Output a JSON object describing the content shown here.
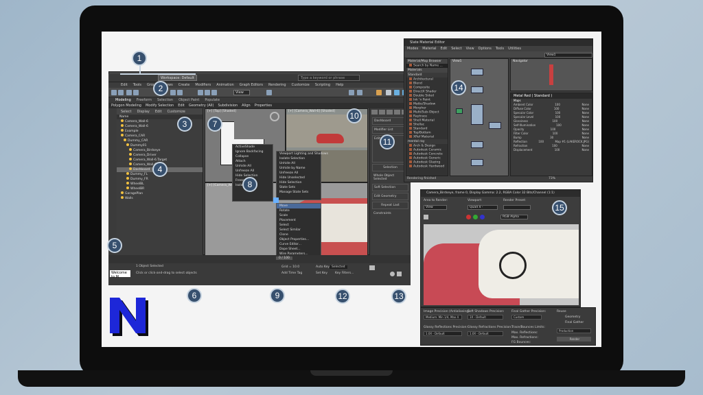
{
  "max": {
    "workspace": "Workspace: Default",
    "search_placeholder": "Type a keyword or phrase",
    "menus": [
      "Edit",
      "Tools",
      "Group",
      "Views",
      "Create",
      "Modifiers",
      "Animation",
      "Graph Editors",
      "Rendering",
      "Customize",
      "Scripting",
      "Help"
    ],
    "ribbon_tabs": [
      "Modeling",
      "Freeform",
      "Selection",
      "Object Paint",
      "Populate"
    ],
    "ribbon_sub": [
      "Polygon Modeling",
      "Modify Selection",
      "Edit",
      "Geometry (All)",
      "Subdivision",
      "Align",
      "Properties"
    ],
    "view_dropdown": "View",
    "scene_tabs": [
      "Select",
      "Display",
      "Edit",
      "Customize"
    ],
    "scene_name_header": "Name",
    "scene_rows": [
      {
        "label": "Camera_Wall-6"
      },
      {
        "label": "Camera_Wall-6"
      },
      {
        "label": "Example"
      },
      {
        "label": "Camera_CAR"
      },
      {
        "label": "Dummy_CAR"
      },
      {
        "label": "Dummy01"
      },
      {
        "label": "Camera_Birdseye"
      },
      {
        "label": "Camera_Driver"
      },
      {
        "label": "Camera_Wall-6.Target"
      },
      {
        "label": "Camera_Wall-6"
      },
      {
        "label": "Dashboard"
      },
      {
        "label": "Dummy_FL"
      },
      {
        "label": "Dummy_FR"
      },
      {
        "label": "WheelBL"
      },
      {
        "label": "WheelBR"
      },
      {
        "label": "GaragePlan"
      },
      {
        "label": "Walls"
      }
    ],
    "viewports": {
      "top_left": "[+] [Top] [Shaded]",
      "top_right": "[+] [Camera_Wall-6] [Shaded]",
      "bottom_left": "[+] [Camera_Wall-6] [Shaded]"
    },
    "quad_left": [
      "ActiveShade",
      "Ignore Backfacing",
      "Collapse",
      "Attach",
      "Unhide All",
      "Unfreeze All",
      "Hide Selection",
      "Freeze",
      "Isolate"
    ],
    "quad_right": [
      "Viewport Lighting and Shadows",
      "Isolate Selection",
      "Unhide All",
      "Unhide by Name",
      "Unfreeze All",
      "Hide Unselected",
      "Hide Selection",
      "State Sets",
      "Manage State Sets"
    ],
    "quad_bottom": [
      "Move",
      "Rotate",
      "Scale",
      "Placement",
      "Select",
      "Select Similar",
      "Clone",
      "Object Properties...",
      "Curve Editor...",
      "Dope Sheet...",
      "Wire Parameters...",
      "Convert To:"
    ],
    "cmd_title": "Dashboard",
    "cmd_modifier_list": "Modifier List",
    "cmd_editable": "Editable Poly",
    "cmd_selection": "Selection",
    "cmd_soft_selection": "Soft Selection",
    "cmd_edit_geometry": "Edit Geometry",
    "cmd_repeat_last": "Repeat Last",
    "cmd_constraints": "Constraints",
    "cmd_constraints_opts": [
      "None",
      "Edge",
      "Face",
      "Normal"
    ],
    "cmd_preserve_uvs": "Preserve UVs",
    "cmd_create": "Create",
    "cmd_whole": "Whole Object Selected",
    "workspace_bottom": "Workspace: Default",
    "selection_set": "Selection Set:",
    "status_object": "1 Object Selected",
    "status_hint": "Click or click-and-drag to select objects",
    "prompt": "Welcome to M",
    "add_time_tag": "Add Time Tag",
    "auto_key": "Auto Key",
    "selected": "Selected",
    "set_key": "Set Key",
    "key_filters": "Key Filters...",
    "grid": "Grid = 10.0",
    "timeline_pos": "0 / 100"
  },
  "sme": {
    "title": "Slate Material Editor",
    "menus": [
      "Modes",
      "Material",
      "Edit",
      "Select",
      "View",
      "Options",
      "Tools",
      "Utilities"
    ],
    "view_dropdown": "View1",
    "browser_title": "Material/Map Browser",
    "browser_search": "Search by Name ...",
    "browser_groups": [
      "Materials",
      "Standard",
      "mental ray"
    ],
    "browser_items": [
      "Architectural",
      "Blend",
      "Composite",
      "DirectX Shader",
      "Double Sided",
      "Ink 'n Paint",
      "Matte/Shadow",
      "Morpher",
      "Multi/Sub-Object",
      "Raytrace",
      "Shell Material",
      "Shellac",
      "Standard",
      "Top/Bottom",
      "XRef Material",
      "Arch & Design",
      "Autodesk Ceramic",
      "Autodesk Concrete",
      "Autodesk Generic",
      "Autodesk Glazing",
      "Autodesk Hardwood"
    ],
    "view_label": "View1",
    "navigator_label": "Navigator",
    "props_title": "Metal Red ( Standard )",
    "props_group": "Maps",
    "props_rows": [
      {
        "name": "Ambient Color",
        "amt": "100",
        "map": "None"
      },
      {
        "name": "Diffuse Color",
        "amt": "100",
        "map": "None"
      },
      {
        "name": "Specular Color",
        "amt": "100",
        "map": "None"
      },
      {
        "name": "Specular Level",
        "amt": "100",
        "map": "None"
      },
      {
        "name": "Glossiness",
        "amt": "100",
        "map": "None"
      },
      {
        "name": "Self-Illumination",
        "amt": "100",
        "map": "None"
      },
      {
        "name": "Opacity",
        "amt": "100",
        "map": "None"
      },
      {
        "name": "Filter Color",
        "amt": "100",
        "map": "None"
      },
      {
        "name": "Bump",
        "amt": "30",
        "map": "None"
      },
      {
        "name": "Reflection",
        "amt": "100",
        "map": "Map #1 (LAKEROCK.JPG)"
      },
      {
        "name": "Refraction",
        "amt": "100",
        "map": "None"
      },
      {
        "name": "Displacement",
        "amt": "100",
        "map": "None"
      }
    ],
    "zoom": "73%",
    "rendering": "Rendering finished"
  },
  "render": {
    "title": "Camera_Birdseye, frame 0, Display Gamma: 2.2, RGBA Color 32 Bits/Channel (1:1)",
    "area_label": "Area to Render:",
    "area_value": "View",
    "viewport_label": "Viewport:",
    "viewport_value": "Quad 4 - Camera_Bi",
    "preset_label": "Render Preset:",
    "preset_value": "",
    "channel_value": "RGB Alpha"
  },
  "settings": {
    "image_precision": "Image Precision (Antialiasing):",
    "image_precision_val": "Medium: Min 1/4, Max 4",
    "soft_shadows": "Soft Shadows Precision:",
    "soft_shadows_val": "1X - Default",
    "final_gather": "Final Gather Precision:",
    "final_gather_val": "Custom",
    "glossy_refl": "Glossy Reflections Precision:",
    "glossy_refl_val": "1.0X - Default",
    "glossy_refr": "Glossy Refractions Precision:",
    "glossy_refr_val": "1.0X - Default",
    "trace_depth": "Trace/Bounces Limits:",
    "max_reflections": "Max. Reflections:",
    "max_refractions": "Max. Refractions:",
    "fg_bounces": "FG Bounces:",
    "reuse": "Reuse",
    "geometry": "Geometry",
    "final_gather_chk": "Final Gather",
    "production": "Production",
    "render_btn": "Render"
  },
  "callouts": [
    "1",
    "2",
    "3",
    "4",
    "5",
    "6",
    "7",
    "8",
    "9",
    "10",
    "11",
    "12",
    "13",
    "14",
    "15"
  ],
  "colors": {
    "accent": "#37506e",
    "logo": "#1d27d8",
    "ui_bg": "#444444"
  }
}
